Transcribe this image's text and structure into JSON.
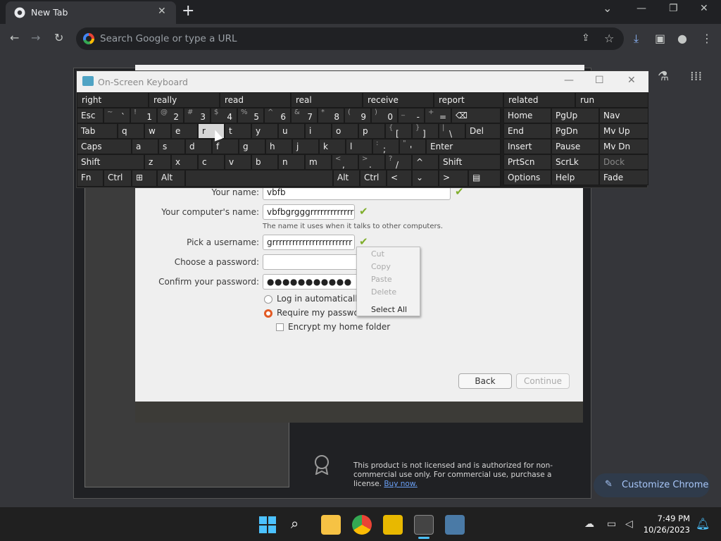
{
  "chrome": {
    "tab_title": "New Tab",
    "tab_close": "✕",
    "new_tab": "+",
    "omnibox_placeholder": "Search Google or type a URL",
    "win_min": "—",
    "win_max": "❐",
    "win_close": "✕",
    "caret": "⌄"
  },
  "osk": {
    "title": "On-Screen Keyboard",
    "predictions": [
      "right",
      "really",
      "read",
      "real",
      "receive",
      "report",
      "related",
      "run"
    ],
    "row1": [
      {
        "main": "Esc"
      },
      {
        "sub": "~",
        "dig": "`"
      },
      {
        "sub": "!",
        "dig": "1"
      },
      {
        "sub": "@",
        "dig": "2"
      },
      {
        "sub": "#",
        "dig": "3"
      },
      {
        "sub": "$",
        "dig": "4"
      },
      {
        "sub": "%",
        "dig": "5"
      },
      {
        "sub": "^",
        "dig": "6"
      },
      {
        "sub": "&",
        "dig": "7"
      },
      {
        "sub": "*",
        "dig": "8"
      },
      {
        "sub": "(",
        "dig": "9"
      },
      {
        "sub": ")",
        "dig": "0"
      },
      {
        "sub": "_",
        "dig": "-"
      },
      {
        "sub": "+",
        "dig": "="
      },
      {
        "main": "⌫"
      }
    ],
    "row2": [
      "Tab",
      "q",
      "w",
      "e",
      "r",
      "t",
      "y",
      "u",
      "i",
      "o",
      "p",
      "[",
      "]",
      "\\",
      "Del"
    ],
    "row2_subs": [
      "",
      "",
      "",
      "",
      "",
      "",
      "",
      "",
      "",
      "",
      "",
      "{",
      "}",
      "|",
      ""
    ],
    "row3": [
      "Caps",
      "a",
      "s",
      "d",
      "f",
      "g",
      "h",
      "j",
      "k",
      "l",
      ";",
      "'",
      "Enter"
    ],
    "row3_subs": [
      "",
      "",
      "",
      "",
      "",
      "",
      "",
      "",
      "",
      "",
      ":",
      "\"",
      ""
    ],
    "row4": [
      "Shift",
      "z",
      "x",
      "c",
      "v",
      "b",
      "n",
      "m",
      ",",
      ".",
      "/",
      "^",
      "Shift"
    ],
    "row4_subs": [
      "",
      "",
      "",
      "",
      "",
      "",
      "",
      "",
      "<",
      ">",
      "?",
      "",
      ""
    ],
    "row5": [
      "Fn",
      "Ctrl",
      "⊞",
      "Alt",
      "",
      "Alt",
      "Ctrl",
      "<",
      "⌄",
      ">",
      "▤"
    ],
    "nav_keys": [
      [
        "Home",
        "PgUp",
        "Nav"
      ],
      [
        "End",
        "PgDn",
        "Mv Up"
      ],
      [
        "Insert",
        "Pause",
        "Mv Dn"
      ],
      [
        "PrtScn",
        "ScrLk",
        "Dock"
      ],
      [
        "Options",
        "Help",
        "Fade"
      ]
    ]
  },
  "installer": {
    "your_name_label": "Your name:",
    "your_name_value": "vbfb",
    "computer_name_label": "Your computer's name:",
    "computer_name_value": "vbfbgrgggrrrrrrrrrrrrrrrr",
    "computer_name_hint": "The name it uses when it talks to other computers.",
    "username_label": "Pick a username:",
    "username_value": "grrrrrrrrrrrrrrrrrrrrrrrr",
    "password_label": "Choose a password:",
    "password_value": "",
    "confirm_label": "Confirm your password:",
    "confirm_value": "●●●●●●●●●●●",
    "opt_login_auto": "Log in automatically",
    "opt_require_pw": "Require my password",
    "opt_encrypt": "Encrypt my home folder",
    "back_button": "Back",
    "continue_button": "Continue",
    "check": "✔"
  },
  "context_menu": {
    "items": [
      "Cut",
      "Copy",
      "Paste",
      "Delete",
      "Select All"
    ]
  },
  "license": {
    "text": "This product is not licensed and is authorized for non-commercial use only. For commercial use, purchase a license.",
    "link": "Buy now."
  },
  "customize_chrome": "Customize Chrome",
  "taskbar": {
    "time": "7:49 PM",
    "date": "10/26/2023"
  }
}
